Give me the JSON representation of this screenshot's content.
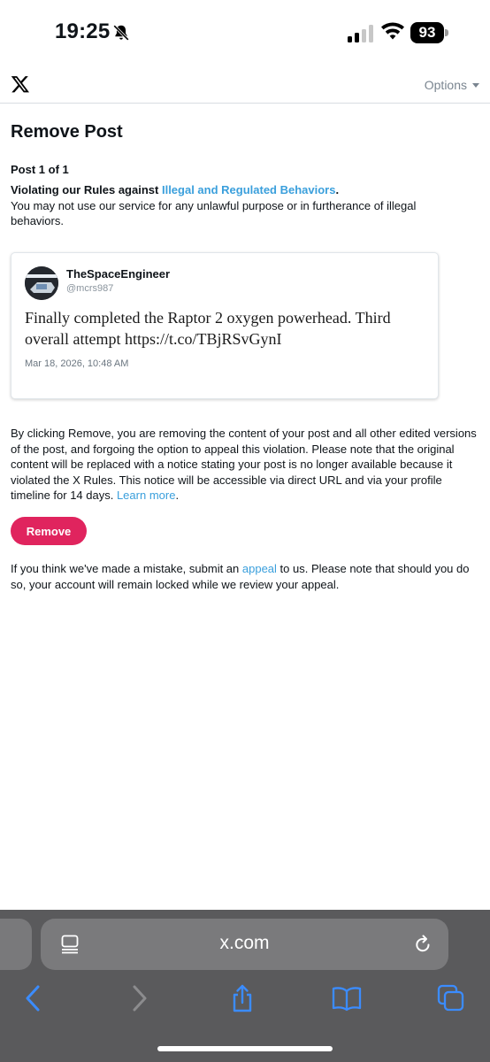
{
  "status_bar": {
    "time": "19:25",
    "battery": "93",
    "icons": [
      "bell-slash-icon",
      "cellular-signal-icon",
      "wifi-icon",
      "battery-icon"
    ]
  },
  "header": {
    "logo": "x-logo-icon",
    "options_label": "Options"
  },
  "page": {
    "title": "Remove Post",
    "post_count": "Post 1 of 1",
    "violation_prefix": "Violating our Rules against ",
    "violation_link": "Illegal and Regulated Behaviors",
    "violation_suffix": ".",
    "violation_description": "You may not use our service for any unlawful purpose or in furtherance of illegal behaviors."
  },
  "tweet": {
    "author_name": "TheSpaceEngineer",
    "author_handle": "@mcrs987",
    "text": "Finally completed the Raptor 2 oxygen powerhead. Third overall attempt https://t.co/TBjRSvGynI",
    "timestamp": "Mar 18, 2026, 10:48 AM"
  },
  "remove_notice": {
    "text": "By clicking Remove, you are removing the content of your post and all other edited versions of the post, and forgoing the option to appeal this violation. Please note that the original content will be replaced with a notice stating your post is no longer available because it violated the X Rules. This notice will be accessible via direct URL and via your profile timeline for 14 days. ",
    "link": "Learn more",
    "suffix": "."
  },
  "remove_button_label": "Remove",
  "appeal_notice": {
    "prefix": "If you think we've made a mistake, submit an ",
    "link": "appeal",
    "suffix": " to us. Please note that should you do so, your account will remain locked while we review your appeal."
  },
  "browser": {
    "url": "x.com",
    "toolbar_icons": [
      "back-icon",
      "forward-icon",
      "share-icon",
      "bookmarks-icon",
      "tabs-icon"
    ]
  },
  "colors": {
    "link": "#3a9fdc",
    "remove_button": "#e0245e",
    "browser_chrome": "#5a5a5c"
  }
}
